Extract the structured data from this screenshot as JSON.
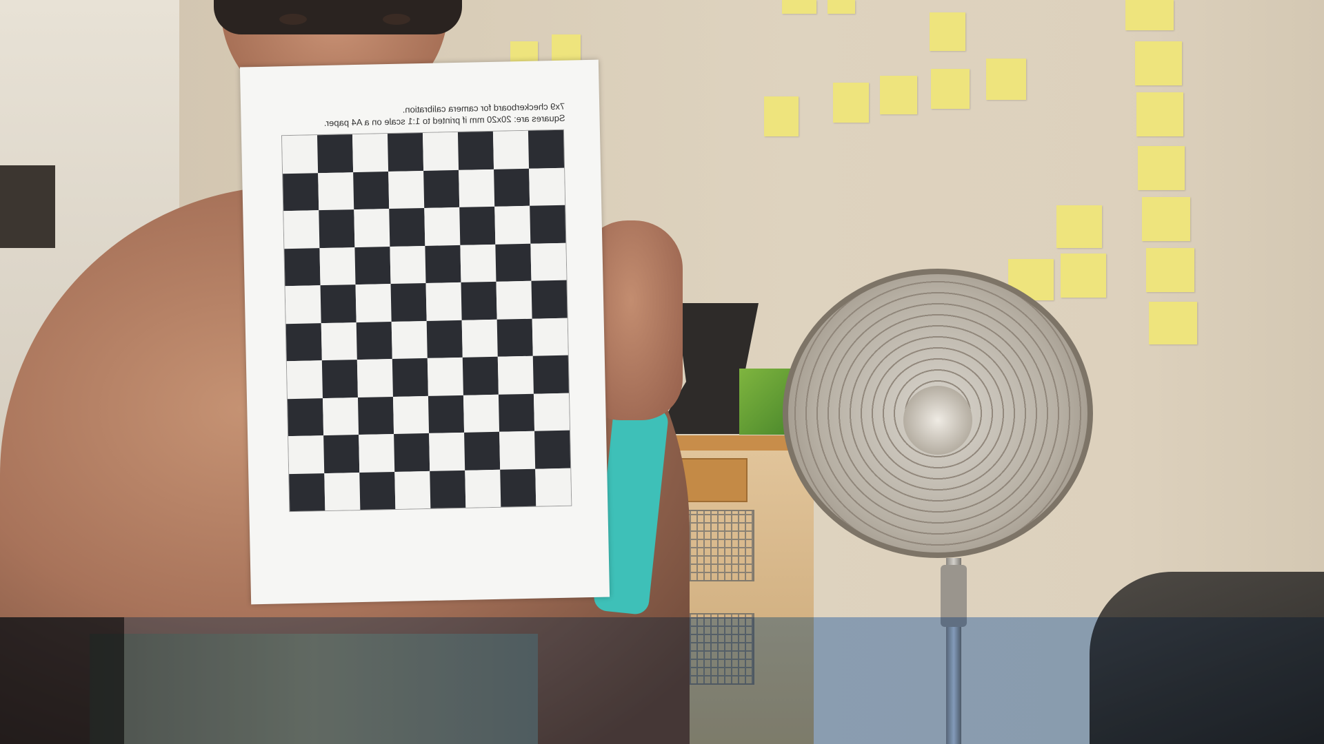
{
  "image": {
    "paper_caption_line1": "7x9 checkerboard for camera calibration.",
    "paper_caption_line2": "Squares are: 20x20 mm if printed to 1:1 scale on a A4 paper.",
    "checkerboard": {
      "columns": 8,
      "rows": 10
    },
    "colors": {
      "paper": "#f6f6f4",
      "dark_square": "#2b2d33",
      "sticky_note": "#eee47d",
      "tint_band": "#286ed2"
    }
  }
}
